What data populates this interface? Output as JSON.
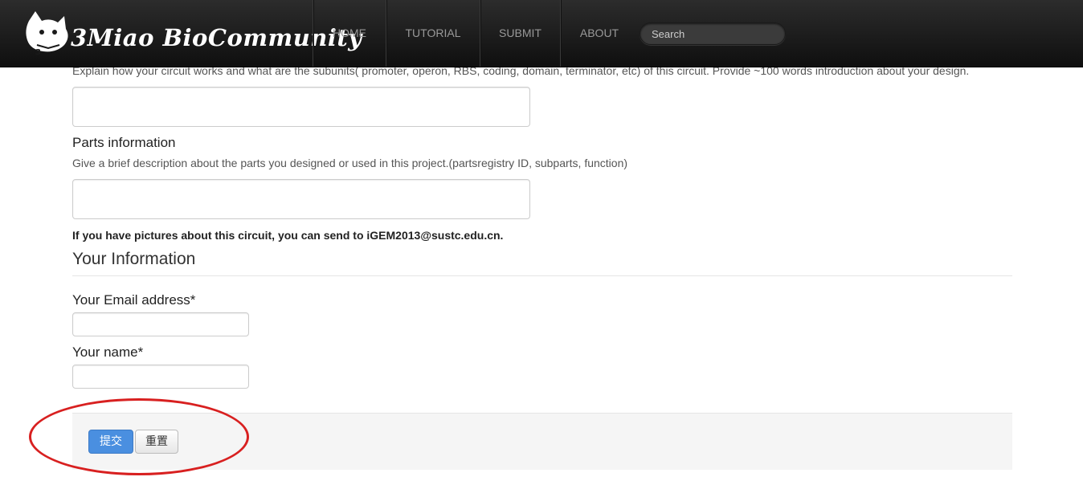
{
  "navbar": {
    "brand": "3Miao BioCommunity",
    "items": [
      {
        "label": "HOME"
      },
      {
        "label": "TUTORIAL"
      },
      {
        "label": "SUBMIT"
      },
      {
        "label": "ABOUT"
      }
    ],
    "search_placeholder": "Search"
  },
  "form": {
    "circuit_help": "Explain how your circuit works and what are the subunits( promoter, operon, RBS, coding, domain, terminator, etc) of this circuit. Provide ~100 words introduction about your design.",
    "parts_label": "Parts information",
    "parts_help": "Give a brief description about the parts you designed or used in this project.(partsregistry ID, subparts, function)",
    "pictures_note": "If you have pictures about this circuit, you can send to iGEM2013@sustc.edu.cn.",
    "your_info_title": "Your Information",
    "email_label": "Your Email address*",
    "name_label": "Your name*",
    "submit_label": "提交",
    "reset_label": "重置"
  },
  "colors": {
    "navbar_bg": "#1a1a1a",
    "primary_button": "#4a8fe0",
    "annotation": "#d82020"
  }
}
